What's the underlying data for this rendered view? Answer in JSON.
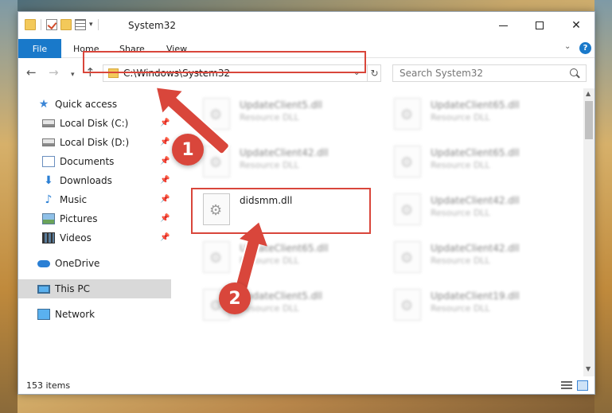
{
  "window": {
    "title": "System32",
    "controls": {
      "minimize": "",
      "maximize": "",
      "close": "✕"
    }
  },
  "ribbon": {
    "tabs": [
      "File",
      "Home",
      "Share",
      "View"
    ],
    "help": "?"
  },
  "address": {
    "path": "C:\\Windows\\System32",
    "search_placeholder": "Search System32"
  },
  "sidebar": {
    "items": [
      {
        "label": "Quick access",
        "icon": "star-icon"
      },
      {
        "label": "Local Disk (C:)",
        "icon": "drive-icon",
        "pinned": true
      },
      {
        "label": "Local Disk (D:)",
        "icon": "drive-icon",
        "pinned": true
      },
      {
        "label": "Documents",
        "icon": "documents-icon",
        "pinned": true
      },
      {
        "label": "Downloads",
        "icon": "download-icon",
        "pinned": true
      },
      {
        "label": "Music",
        "icon": "music-icon",
        "pinned": true
      },
      {
        "label": "Pictures",
        "icon": "pictures-icon",
        "pinned": true
      },
      {
        "label": "Videos",
        "icon": "videos-icon",
        "pinned": true
      },
      {
        "label": "OneDrive",
        "icon": "cloud-icon"
      },
      {
        "label": "This PC",
        "icon": "computer-icon",
        "selected": true
      },
      {
        "label": "Network",
        "icon": "network-icon"
      }
    ]
  },
  "files": [
    {
      "name": "UpdateClient5.dll",
      "desc": "Resource DLL",
      "blurred": true
    },
    {
      "name": "UpdateClient65.dll",
      "desc": "Resource DLL",
      "blurred": true
    },
    {
      "name": "UpdateClient42.dll",
      "desc": "Resource DLL",
      "blurred": true
    },
    {
      "name": "UpdateClient65.dll",
      "desc": "Resource DLL",
      "blurred": true
    },
    {
      "name": "didsmm.dll",
      "desc": "",
      "blurred": false
    },
    {
      "name": "UpdateClient42.dll",
      "desc": "Resource DLL",
      "blurred": true
    },
    {
      "name": "UpdateClient65.dll",
      "desc": "Resource DLL",
      "blurred": true
    },
    {
      "name": "UpdateClient42.dll",
      "desc": "Resource DLL",
      "blurred": true
    },
    {
      "name": "UpdateClient5.dll",
      "desc": "Resource DLL",
      "blurred": true
    },
    {
      "name": "UpdateClient19.dll",
      "desc": "Resource DLL",
      "blurred": true
    }
  ],
  "status": {
    "count": "153 items"
  },
  "annotations": {
    "step1": "1",
    "step2": "2"
  },
  "colors": {
    "accent": "#1979ca",
    "highlight": "#d9463b"
  }
}
